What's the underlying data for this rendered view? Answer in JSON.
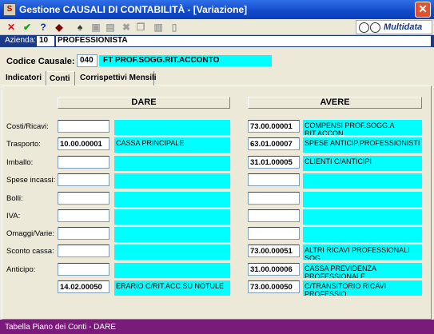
{
  "window": {
    "title": "Gestione CAUSALI DI CONTABILITÀ - [Variazione]",
    "close_glyph": "✕",
    "app_icon_glyph": "S"
  },
  "toolbar": {
    "icons": [
      {
        "name": "cancel-icon",
        "glyph": "✕",
        "color": "#d01010"
      },
      {
        "name": "confirm-icon",
        "glyph": "✔",
        "color": "#10a010"
      },
      {
        "name": "help-icon",
        "glyph": "?",
        "color": "#1030c0"
      },
      {
        "name": "book-icon",
        "glyph": "◆",
        "color": "#800000"
      },
      {
        "name": "binoculars-icon",
        "glyph": "♠",
        "color": "#333333"
      },
      {
        "name": "new-icon",
        "glyph": "▣",
        "color": "#a0a0a0"
      },
      {
        "name": "save-icon",
        "glyph": "▤",
        "color": "#a0a0a0"
      },
      {
        "name": "delete-icon",
        "glyph": "✖",
        "color": "#a0a0a0"
      },
      {
        "name": "copy-icon",
        "glyph": "❐",
        "color": "#a0a0a0"
      },
      {
        "name": "paste-icon",
        "glyph": "▥",
        "color": "#a0a0a0"
      },
      {
        "name": "document-icon",
        "glyph": "▯",
        "color": "#a0a0a0"
      }
    ],
    "logo": "Multidata"
  },
  "azienda": {
    "label": "Azienda:",
    "code": "10",
    "name": "PROFESSIONISTA"
  },
  "causale": {
    "label": "Codice Causale:",
    "code": "040",
    "description": "FT PROF.SOGG.RIT.ACCONTO"
  },
  "tabs": [
    {
      "label": "Indicatori",
      "selected": false
    },
    {
      "label": "Conti",
      "selected": true
    },
    {
      "label": "Corrispettivi Mensili",
      "selected": false
    }
  ],
  "headers": {
    "dare": "DARE",
    "avere": "AVERE"
  },
  "rows": [
    {
      "label": "Costi/Ricavi:",
      "dare_code": "",
      "dare_desc": "",
      "avere_code": "73.00.00001",
      "avere_desc": "COMPENSI PROF.SOGG.A RIT.ACCON"
    },
    {
      "label": "Trasporto:",
      "dare_code": "10.00.00001",
      "dare_desc": "CASSA PRINCIPALE",
      "avere_code": "63.01.00007",
      "avere_desc": "SPESE ANTICIP.PROFESSIONISTI"
    },
    {
      "label": "Imballo:",
      "dare_code": "",
      "dare_desc": "",
      "avere_code": "31.01.00005",
      "avere_desc": "CLIENTI C/ANTICIPI"
    },
    {
      "label": "Spese incassi:",
      "dare_code": "",
      "dare_desc": "",
      "avere_code": "",
      "avere_desc": ""
    },
    {
      "label": "Bolli:",
      "dare_code": "",
      "dare_desc": "",
      "avere_code": "",
      "avere_desc": ""
    },
    {
      "label": "IVA:",
      "dare_code": "",
      "dare_desc": "",
      "avere_code": "",
      "avere_desc": ""
    },
    {
      "label": "Omaggi/Varie:",
      "dare_code": "",
      "dare_desc": "",
      "avere_code": "",
      "avere_desc": ""
    },
    {
      "label": "Sconto cassa:",
      "dare_code": "",
      "dare_desc": "",
      "avere_code": "73.00.00051",
      "avere_desc": "ALTRI RICAVI PROFESSIONALI SOG"
    },
    {
      "label": "Anticipo:",
      "dare_code": "",
      "dare_desc": "",
      "avere_code": "31.00.00006",
      "avere_desc": "CASSA PREVIDENZA PROFESSIONALE"
    },
    {
      "label": "",
      "dare_code": "14.02.00050",
      "dare_desc": "ERARIO C/RIT.ACC.SU NOTULE",
      "avere_code": "73.00.00050",
      "avere_desc": "C/TRANSITORIO RICAVI PROFESSIO"
    }
  ],
  "status": "Tabella Piano dei Conti - DARE",
  "colors": {
    "accent": "#00ffff",
    "title_bar": "#1149c9",
    "status_bar": "#7a1a7a"
  }
}
